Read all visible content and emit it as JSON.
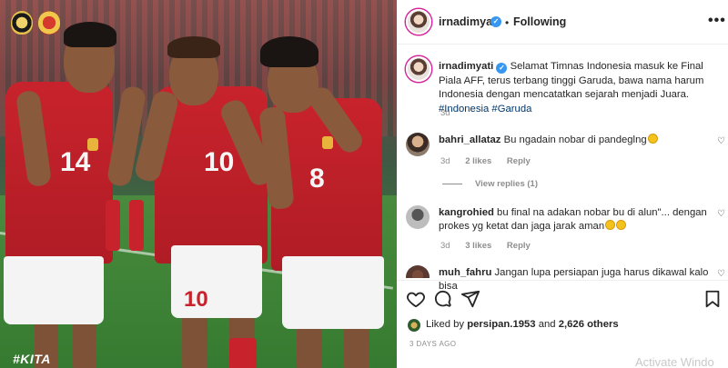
{
  "photo": {
    "overlay_hashtag": "#KITA",
    "players": [
      {
        "shirt_number": "14"
      },
      {
        "shirt_number": "10",
        "shorts_number": "10"
      },
      {
        "shirt_number": "8"
      }
    ],
    "colors": {
      "jersey_red": "#c8232c",
      "shorts_white": "#f4f4f4",
      "pitch_green": "#3d8236"
    }
  },
  "header": {
    "username": "irnadimyati",
    "verified": true,
    "separator": "•",
    "follow_status": "Following",
    "more_icon": "more-horizontal-icon"
  },
  "post": {
    "username": "irnadimyati",
    "caption_text": "Selamat Timnas Indonesia masuk ke Final Piala AFF, terus terbang tinggi Garuda, bawa nama harum Indonesia dengan mencatatkan sejarah menjadi Juara.",
    "hashtags": [
      "#Indonesia",
      "#Garuda"
    ],
    "time": "3d"
  },
  "comments": [
    {
      "username": "bahri_allataz",
      "text": "Bu ngadain nobar di pandeglng",
      "time": "3d",
      "likes": "2 likes",
      "reply_label": "Reply",
      "view_replies": "View replies (1)"
    },
    {
      "username": "kangrohied",
      "text": "bu final na adakan nobar bu di alun\"... dengan prokes yg ketat dan jaga jarak aman",
      "time": "3d",
      "likes": "3 likes",
      "reply_label": "Reply"
    },
    {
      "username": "muh_fahru",
      "text": "Jangan lupa persiapan juga harus dikawal kalo bisa"
    }
  ],
  "actions": {
    "like_icon": "heart-icon",
    "comment_icon": "comment-icon",
    "share_icon": "share-icon",
    "save_icon": "bookmark-icon"
  },
  "likes": {
    "prefix": "Liked by",
    "first_user": "persipan.1953",
    "connector": "and",
    "others": "2,626 others"
  },
  "posted_ago": "3 DAYS AGO",
  "watermark": "Activate Windo",
  "colors": {
    "link_blue": "#00376b",
    "verified_blue": "#3897f0",
    "muted": "#8e8e8e",
    "text": "#262626"
  }
}
